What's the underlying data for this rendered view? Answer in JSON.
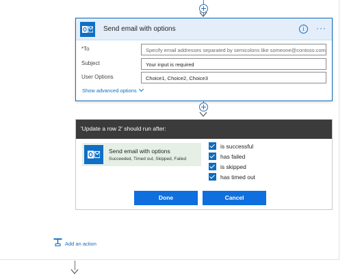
{
  "email_card": {
    "title": "Send email with options",
    "info_glyph": "i",
    "more_glyph": "···",
    "icon": "outlook-icon",
    "fields": [
      {
        "label": "*To",
        "value": "",
        "placeholder": "Specify email addresses separated by semicolons like someone@contoso.com"
      },
      {
        "label": "Subject",
        "value": "Your input is required",
        "placeholder": ""
      },
      {
        "label": "User Options",
        "value": "Choice1, Choice2, Choice3",
        "placeholder": ""
      }
    ],
    "show_advanced": "Show advanced options"
  },
  "run_after": {
    "header": "'Update a row 2' should run after:",
    "action": {
      "title": "Send email with options",
      "subtitle": "Succeeded, Timed out, Skipped, Failed",
      "icon": "outlook-icon"
    },
    "options": [
      {
        "label": "is successful",
        "checked": true
      },
      {
        "label": "has failed",
        "checked": true
      },
      {
        "label": "is skipped",
        "checked": true
      },
      {
        "label": "has timed out",
        "checked": true
      }
    ],
    "done_label": "Done",
    "cancel_label": "Cancel"
  },
  "add_action": {
    "label": "Add an action",
    "icon": "add-action-icon"
  },
  "colors": {
    "accent": "#0f6cbd",
    "button": "#0f6fde",
    "header_dark": "#3b3b3b",
    "card_header": "#e3eefa",
    "chip": "#e6efe6"
  }
}
